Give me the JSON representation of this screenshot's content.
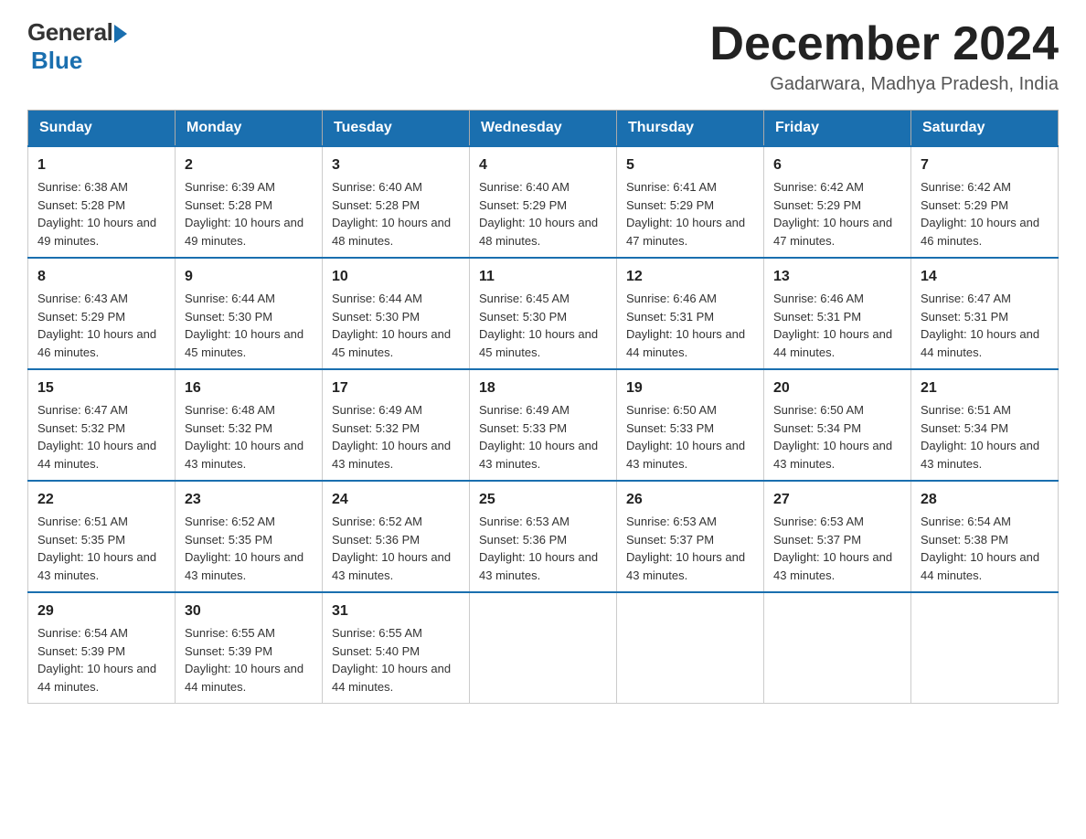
{
  "logo": {
    "general": "General",
    "blue": "Blue"
  },
  "title": "December 2024",
  "location": "Gadarwara, Madhya Pradesh, India",
  "days_of_week": [
    "Sunday",
    "Monday",
    "Tuesday",
    "Wednesday",
    "Thursday",
    "Friday",
    "Saturday"
  ],
  "weeks": [
    [
      {
        "day": "1",
        "sunrise": "6:38 AM",
        "sunset": "5:28 PM",
        "daylight": "10 hours and 49 minutes."
      },
      {
        "day": "2",
        "sunrise": "6:39 AM",
        "sunset": "5:28 PM",
        "daylight": "10 hours and 49 minutes."
      },
      {
        "day": "3",
        "sunrise": "6:40 AM",
        "sunset": "5:28 PM",
        "daylight": "10 hours and 48 minutes."
      },
      {
        "day": "4",
        "sunrise": "6:40 AM",
        "sunset": "5:29 PM",
        "daylight": "10 hours and 48 minutes."
      },
      {
        "day": "5",
        "sunrise": "6:41 AM",
        "sunset": "5:29 PM",
        "daylight": "10 hours and 47 minutes."
      },
      {
        "day": "6",
        "sunrise": "6:42 AM",
        "sunset": "5:29 PM",
        "daylight": "10 hours and 47 minutes."
      },
      {
        "day": "7",
        "sunrise": "6:42 AM",
        "sunset": "5:29 PM",
        "daylight": "10 hours and 46 minutes."
      }
    ],
    [
      {
        "day": "8",
        "sunrise": "6:43 AM",
        "sunset": "5:29 PM",
        "daylight": "10 hours and 46 minutes."
      },
      {
        "day": "9",
        "sunrise": "6:44 AM",
        "sunset": "5:30 PM",
        "daylight": "10 hours and 45 minutes."
      },
      {
        "day": "10",
        "sunrise": "6:44 AM",
        "sunset": "5:30 PM",
        "daylight": "10 hours and 45 minutes."
      },
      {
        "day": "11",
        "sunrise": "6:45 AM",
        "sunset": "5:30 PM",
        "daylight": "10 hours and 45 minutes."
      },
      {
        "day": "12",
        "sunrise": "6:46 AM",
        "sunset": "5:31 PM",
        "daylight": "10 hours and 44 minutes."
      },
      {
        "day": "13",
        "sunrise": "6:46 AM",
        "sunset": "5:31 PM",
        "daylight": "10 hours and 44 minutes."
      },
      {
        "day": "14",
        "sunrise": "6:47 AM",
        "sunset": "5:31 PM",
        "daylight": "10 hours and 44 minutes."
      }
    ],
    [
      {
        "day": "15",
        "sunrise": "6:47 AM",
        "sunset": "5:32 PM",
        "daylight": "10 hours and 44 minutes."
      },
      {
        "day": "16",
        "sunrise": "6:48 AM",
        "sunset": "5:32 PM",
        "daylight": "10 hours and 43 minutes."
      },
      {
        "day": "17",
        "sunrise": "6:49 AM",
        "sunset": "5:32 PM",
        "daylight": "10 hours and 43 minutes."
      },
      {
        "day": "18",
        "sunrise": "6:49 AM",
        "sunset": "5:33 PM",
        "daylight": "10 hours and 43 minutes."
      },
      {
        "day": "19",
        "sunrise": "6:50 AM",
        "sunset": "5:33 PM",
        "daylight": "10 hours and 43 minutes."
      },
      {
        "day": "20",
        "sunrise": "6:50 AM",
        "sunset": "5:34 PM",
        "daylight": "10 hours and 43 minutes."
      },
      {
        "day": "21",
        "sunrise": "6:51 AM",
        "sunset": "5:34 PM",
        "daylight": "10 hours and 43 minutes."
      }
    ],
    [
      {
        "day": "22",
        "sunrise": "6:51 AM",
        "sunset": "5:35 PM",
        "daylight": "10 hours and 43 minutes."
      },
      {
        "day": "23",
        "sunrise": "6:52 AM",
        "sunset": "5:35 PM",
        "daylight": "10 hours and 43 minutes."
      },
      {
        "day": "24",
        "sunrise": "6:52 AM",
        "sunset": "5:36 PM",
        "daylight": "10 hours and 43 minutes."
      },
      {
        "day": "25",
        "sunrise": "6:53 AM",
        "sunset": "5:36 PM",
        "daylight": "10 hours and 43 minutes."
      },
      {
        "day": "26",
        "sunrise": "6:53 AM",
        "sunset": "5:37 PM",
        "daylight": "10 hours and 43 minutes."
      },
      {
        "day": "27",
        "sunrise": "6:53 AM",
        "sunset": "5:37 PM",
        "daylight": "10 hours and 43 minutes."
      },
      {
        "day": "28",
        "sunrise": "6:54 AM",
        "sunset": "5:38 PM",
        "daylight": "10 hours and 44 minutes."
      }
    ],
    [
      {
        "day": "29",
        "sunrise": "6:54 AM",
        "sunset": "5:39 PM",
        "daylight": "10 hours and 44 minutes."
      },
      {
        "day": "30",
        "sunrise": "6:55 AM",
        "sunset": "5:39 PM",
        "daylight": "10 hours and 44 minutes."
      },
      {
        "day": "31",
        "sunrise": "6:55 AM",
        "sunset": "5:40 PM",
        "daylight": "10 hours and 44 minutes."
      },
      null,
      null,
      null,
      null
    ]
  ]
}
